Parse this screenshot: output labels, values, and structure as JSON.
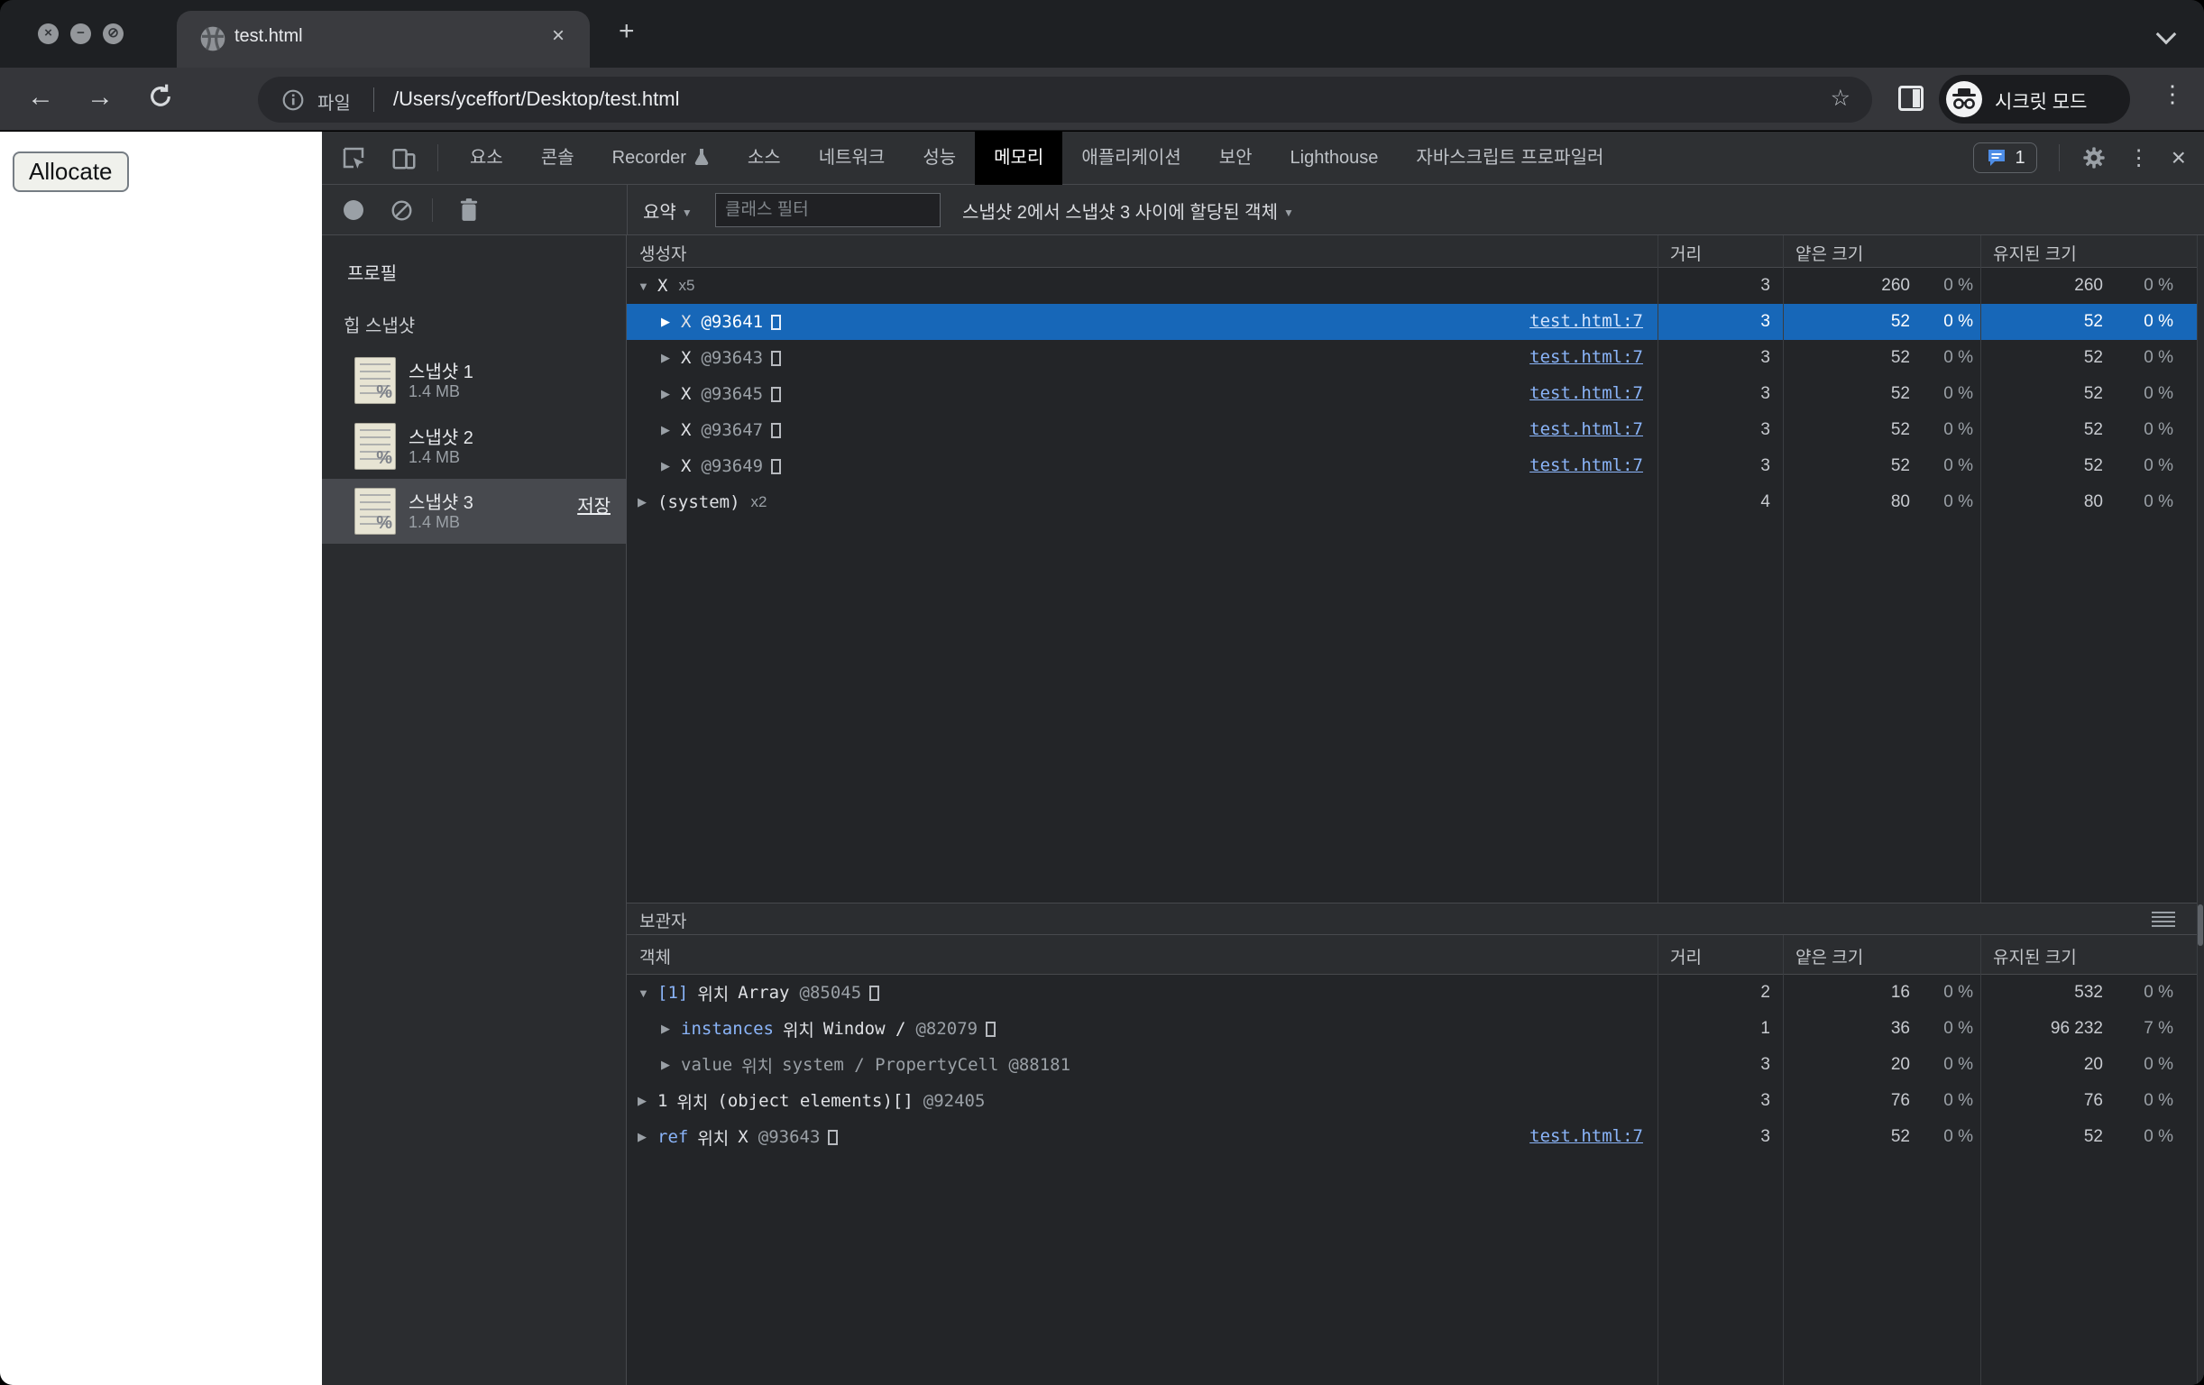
{
  "browser": {
    "tab_title": "test.html",
    "new_tab": "+",
    "url_chip": "파일",
    "url": "/Users/yceffort/Desktop/test.html",
    "incognito_label": "시크릿 모드",
    "close_glyph": "✕"
  },
  "page": {
    "allocate_label": "Allocate"
  },
  "devtools": {
    "tab_labels": [
      "요소",
      "콘솔",
      "Recorder",
      "소스",
      "네트워크",
      "성능",
      "메모리",
      "애플리케이션",
      "보안",
      "Lighthouse",
      "자바스크립트 프로파일러"
    ],
    "issues_count": "1",
    "toolbar": {
      "summary_label": "요약",
      "filter_placeholder": "클래스 필터",
      "scope_label": "스냅샷 2에서 스냅샷 3 사이에 할당된 객체"
    },
    "sidebar": {
      "title": "프로필",
      "section": "힙 스냅샷",
      "snapshots": [
        {
          "name": "스냅샷 1",
          "size": "1.4 MB"
        },
        {
          "name": "스냅샷 2",
          "size": "1.4 MB"
        },
        {
          "name": "스냅샷 3",
          "size": "1.4 MB",
          "action": "저장"
        }
      ]
    },
    "grid": {
      "col_constructor": "생성자",
      "col_object": "객체",
      "col_distance": "거리",
      "col_shallow": "얕은 크기",
      "col_retained": "유지된 크기",
      "retainers_title": "보관자"
    },
    "constructors": {
      "rows": [
        {
          "arrow": "▼",
          "name": "X",
          "count": "x5",
          "d": "3",
          "s": "260",
          "sp": "0 %",
          "r": "260",
          "rp": "0 %"
        },
        {
          "arrow": "▶",
          "name": "X",
          "id": "@93641",
          "link": "test.html:7",
          "d": "3",
          "s": "52",
          "sp": "0 %",
          "r": "52",
          "rp": "0 %"
        },
        {
          "arrow": "▶",
          "name": "X",
          "id": "@93643",
          "link": "test.html:7",
          "d": "3",
          "s": "52",
          "sp": "0 %",
          "r": "52",
          "rp": "0 %"
        },
        {
          "arrow": "▶",
          "name": "X",
          "id": "@93645",
          "link": "test.html:7",
          "d": "3",
          "s": "52",
          "sp": "0 %",
          "r": "52",
          "rp": "0 %"
        },
        {
          "arrow": "▶",
          "name": "X",
          "id": "@93647",
          "link": "test.html:7",
          "d": "3",
          "s": "52",
          "sp": "0 %",
          "r": "52",
          "rp": "0 %"
        },
        {
          "arrow": "▶",
          "name": "X",
          "id": "@93649",
          "link": "test.html:7",
          "d": "3",
          "s": "52",
          "sp": "0 %",
          "r": "52",
          "rp": "0 %"
        },
        {
          "arrow": "▶",
          "name": "(system)",
          "count": "x2",
          "d": "4",
          "s": "80",
          "sp": "0 %",
          "r": "80",
          "rp": "0 %"
        }
      ]
    },
    "retainers": {
      "in_label": "위치",
      "rows": [
        {
          "arrow": "▼",
          "name": "[1]",
          "target": "Array",
          "id": "@85045",
          "d": "2",
          "s": "16",
          "sp": "0 %",
          "r": "532",
          "rp": "0 %"
        },
        {
          "arrow": "▶",
          "name": "instances",
          "target": "Window /",
          "id": "@82079",
          "d": "1",
          "s": "36",
          "sp": "0 %",
          "r": "96 232",
          "rp": "7 %"
        },
        {
          "arrow": "▶",
          "name": "value",
          "target": "system / PropertyCell",
          "id": "@88181",
          "d": "3",
          "s": "20",
          "sp": "0 %",
          "r": "20",
          "rp": "0 %"
        },
        {
          "arrow": "▶",
          "name": "1",
          "target": "(object elements)[]",
          "id": "@92405",
          "d": "3",
          "s": "76",
          "sp": "0 %",
          "r": "76",
          "rp": "0 %"
        },
        {
          "arrow": "▶",
          "name": "ref",
          "target": "X",
          "id": "@93643",
          "link": "test.html:7",
          "d": "3",
          "s": "52",
          "sp": "0 %",
          "r": "52",
          "rp": "0 %"
        }
      ]
    }
  }
}
